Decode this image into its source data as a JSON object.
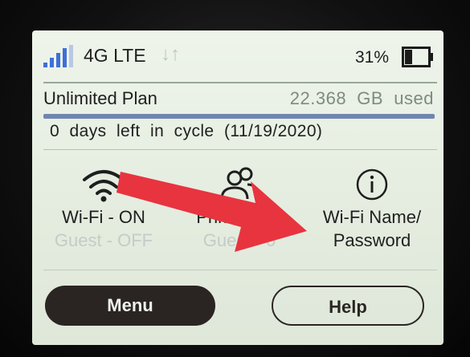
{
  "status": {
    "network_label": "4G LTE",
    "data_arrows": "↓↑",
    "battery_percent": "31%",
    "battery_level": 0.31,
    "signal_bars": 4
  },
  "plan": {
    "name": "Unlimited Plan",
    "usage": "22.368  GB  used",
    "cycle_text": "0  days  left  in  cycle  (11/19/2020)",
    "cycle_progress": 1.0
  },
  "tiles": {
    "wifi": {
      "line1": "Wi-Fi - ON",
      "line2": "Guest - OFF"
    },
    "users": {
      "line1": "Primary - 2",
      "line2": "Guest - 0"
    },
    "info": {
      "line1": "Wi-Fi Name/",
      "line2": "Password"
    }
  },
  "buttons": {
    "menu_label": "Menu",
    "help_label": "Help"
  },
  "colors": {
    "annotation_arrow": "#e8343f",
    "button_dark": "#2a2522",
    "progress_bar": "#6f86b0"
  }
}
